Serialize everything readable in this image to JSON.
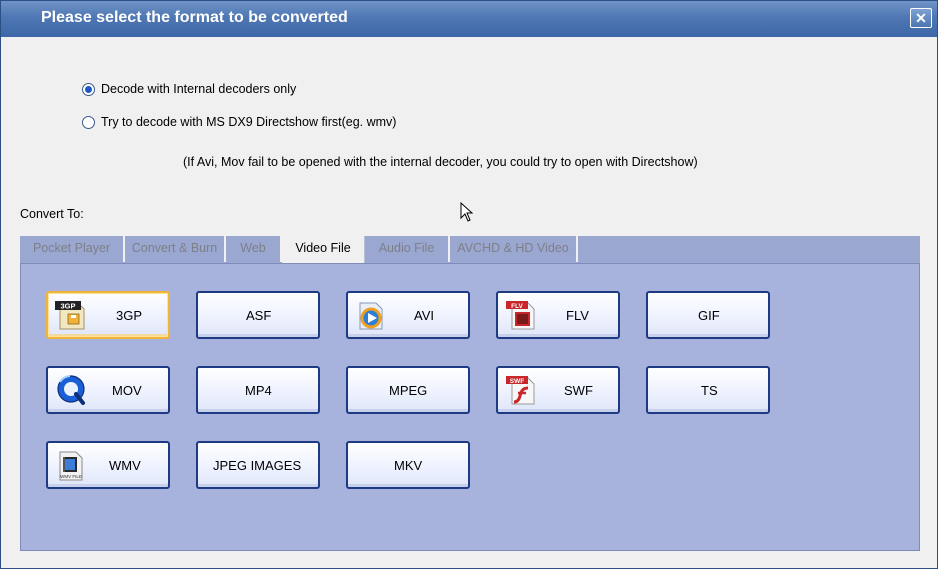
{
  "window": {
    "title": "Please select the format to be converted",
    "close_glyph": "✕"
  },
  "decode_options": [
    {
      "label": "Decode with Internal decoders only",
      "checked": true
    },
    {
      "label": "Try to decode with MS DX9 Directshow first(eg. wmv)",
      "checked": false
    }
  ],
  "note": "(If Avi, Mov fail to be opened with the internal decoder, you could try to open with Directshow)",
  "convert_to_label": "Convert To:",
  "tabs": [
    {
      "label": "Pocket  Player",
      "active": false
    },
    {
      "label": "Convert & Burn",
      "active": false
    },
    {
      "label": "Web",
      "active": false
    },
    {
      "label": "Video  File",
      "active": true
    },
    {
      "label": "Audio  File",
      "active": false
    },
    {
      "label": "AVCHD & HD Video",
      "active": false
    }
  ],
  "formats": [
    {
      "label": "3GP",
      "icon": "3gp-file-icon",
      "selected": true
    },
    {
      "label": "ASF",
      "icon": "",
      "selected": false
    },
    {
      "label": "AVI",
      "icon": "avi-media-icon",
      "selected": false
    },
    {
      "label": "FLV",
      "icon": "flv-file-icon",
      "selected": false
    },
    {
      "label": "GIF",
      "icon": "",
      "selected": false
    },
    {
      "label": "MOV",
      "icon": "quicktime-icon",
      "selected": false
    },
    {
      "label": "MP4",
      "icon": "",
      "selected": false
    },
    {
      "label": "MPEG",
      "icon": "",
      "selected": false
    },
    {
      "label": "SWF",
      "icon": "swf-flash-file-icon",
      "selected": false
    },
    {
      "label": "TS",
      "icon": "",
      "selected": false
    },
    {
      "label": "WMV",
      "icon": "wmv-film-file-icon",
      "selected": false
    },
    {
      "label": "JPEG IMAGES",
      "icon": "",
      "selected": false
    },
    {
      "label": "MKV",
      "icon": "",
      "selected": false
    }
  ],
  "icon_texts": {
    "tgp_badge": "3GP",
    "flv_badge": "FLV",
    "swf_badge": "SWF",
    "wmv_caption": "WMV FILE"
  },
  "colors": {
    "titlebar": "#4f77b3",
    "panel": "#a7b3dd",
    "button_border": "#1d3a82",
    "selected_border": "#f0b438"
  }
}
